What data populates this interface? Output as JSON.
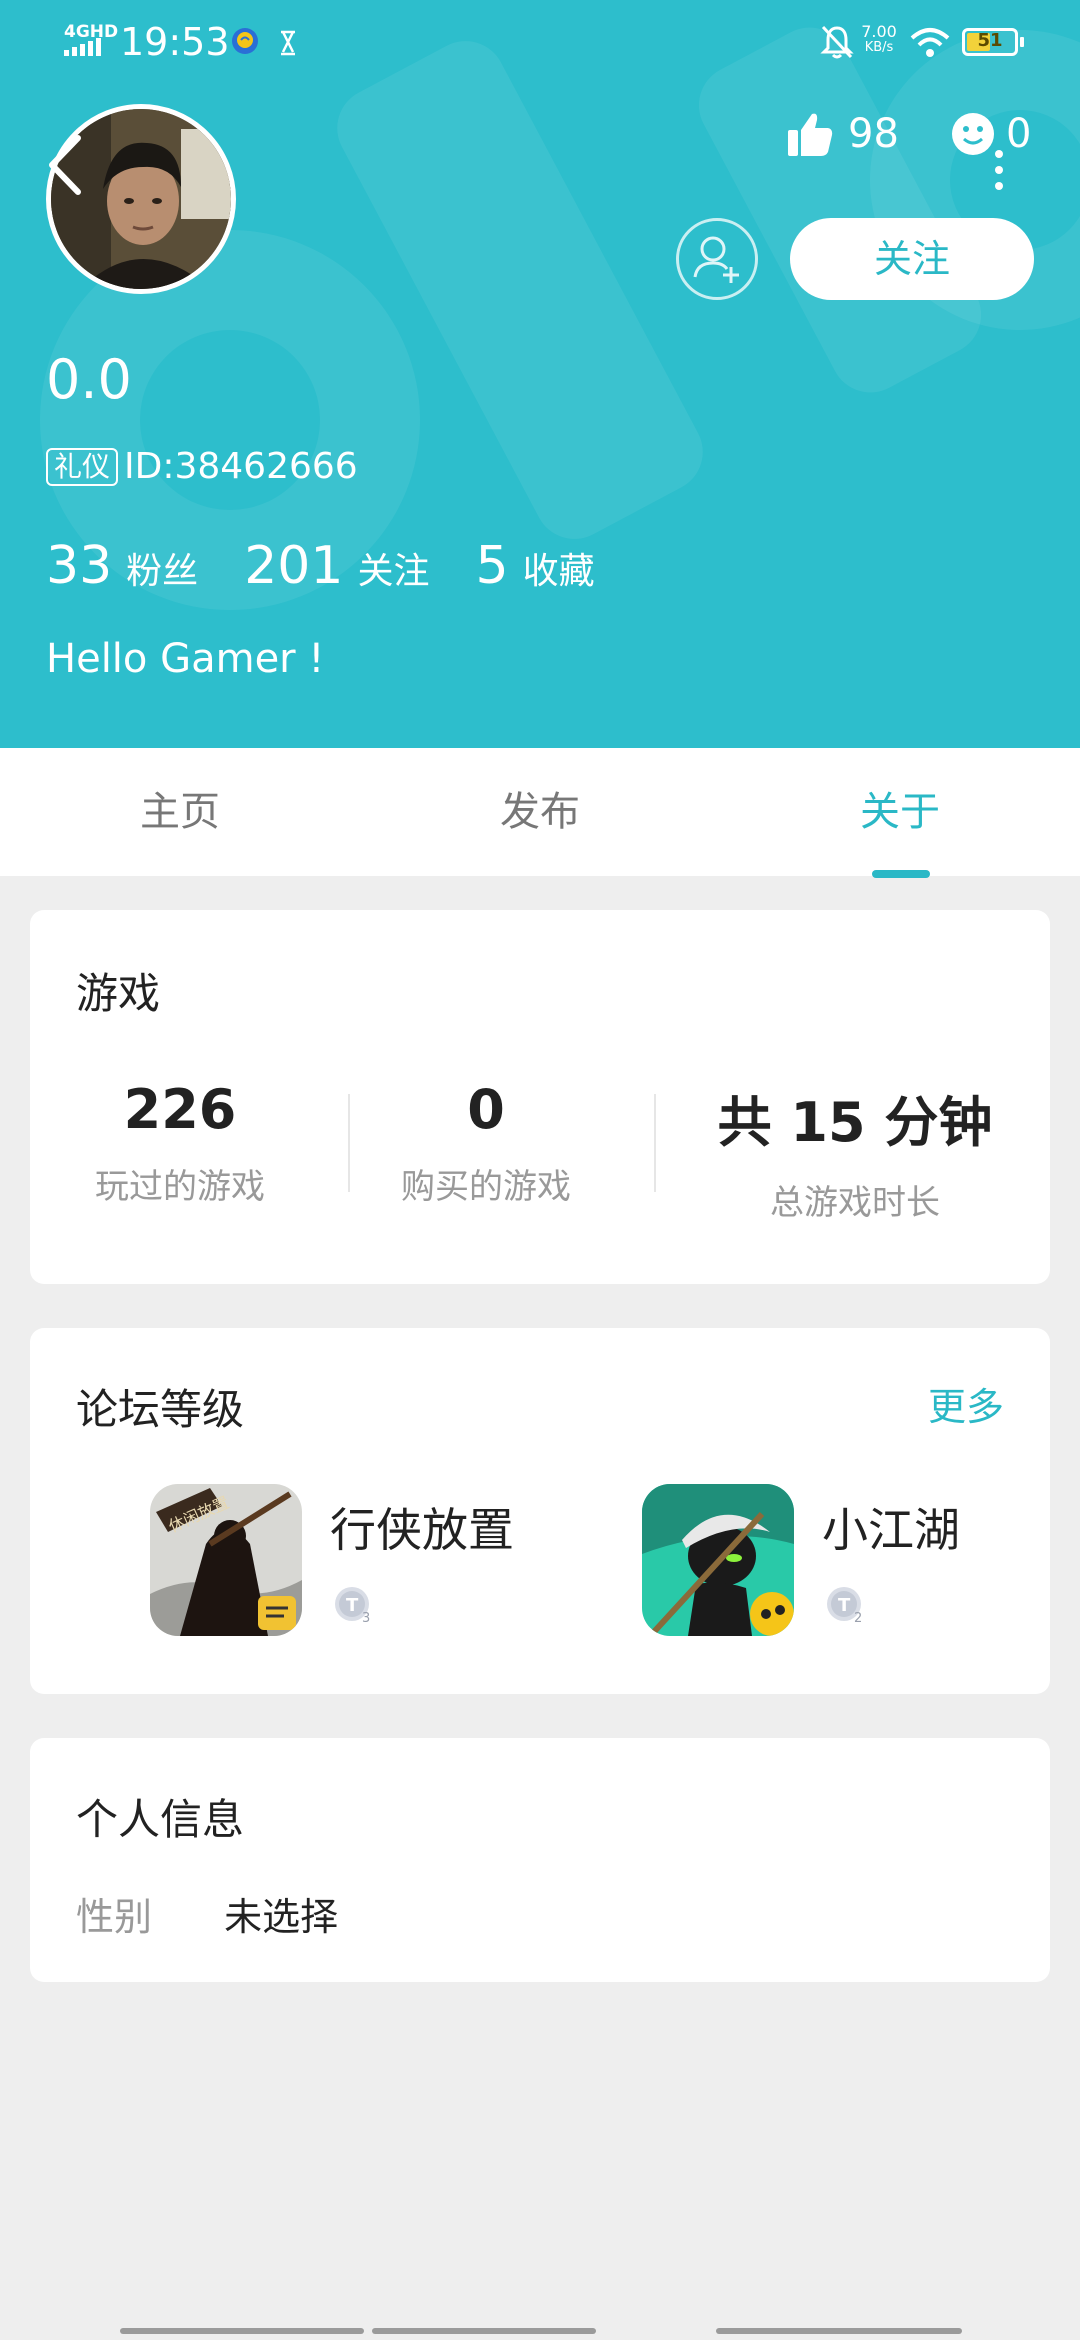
{
  "status_bar": {
    "network": "4GHD",
    "time": "19:53",
    "speed_value": "7.00",
    "speed_unit": "KB/s",
    "battery": "51",
    "battery_level": 0.51
  },
  "profile": {
    "name": "0.0",
    "tag": "礼仪",
    "id": "ID:38462666",
    "likes": "98",
    "smiles": "0",
    "follow_label": "关注",
    "stats": [
      {
        "num": "33",
        "label": "粉丝"
      },
      {
        "num": "201",
        "label": "关注"
      },
      {
        "num": "5",
        "label": "收藏"
      }
    ],
    "bio": "Hello Gamer !"
  },
  "tabs": [
    {
      "label": "主页",
      "active": false
    },
    {
      "label": "发布",
      "active": false
    },
    {
      "label": "关于",
      "active": true
    }
  ],
  "games_card": {
    "title": "游戏",
    "stats": [
      {
        "num": "226",
        "label": "玩过的游戏"
      },
      {
        "num": "0",
        "label": "购买的游戏"
      },
      {
        "num": "共 15 分钟",
        "label": "总游戏时长"
      }
    ]
  },
  "forum_card": {
    "title": "论坛等级",
    "more": "更多",
    "items": [
      {
        "name": "行侠放置",
        "icon_text": "休闲放置",
        "level": "3"
      },
      {
        "name": "小江湖",
        "level": "2"
      }
    ]
  },
  "info_card": {
    "title": "个人信息",
    "rows": [
      {
        "key": "性别",
        "value": "未选择"
      }
    ]
  },
  "colors": {
    "accent": "#2ab8c6",
    "header_bg": "#2dbecc",
    "page_bg": "#eeeeee"
  }
}
